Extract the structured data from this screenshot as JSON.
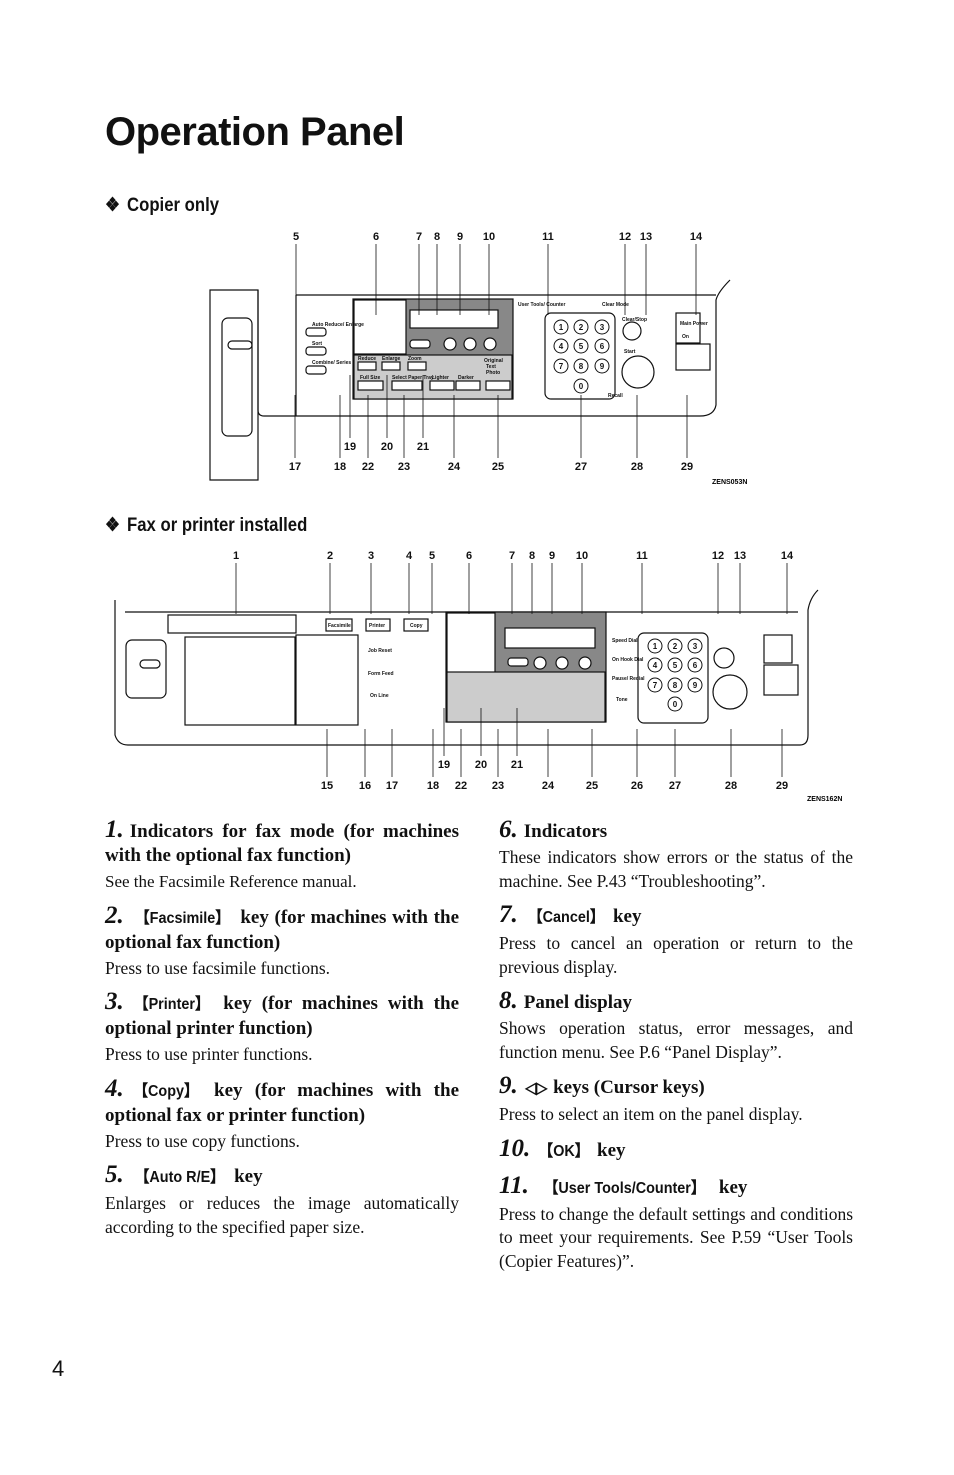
{
  "title": "Operation Panel",
  "sections": [
    {
      "heading": "Copier only",
      "figure_code": "ZENS053N",
      "callouts": [
        "5",
        "6",
        "7",
        "8",
        "9",
        "10",
        "11",
        "12",
        "13",
        "14",
        "17",
        "18",
        "22",
        "23",
        "24",
        "25",
        "27",
        "28",
        "29",
        "19",
        "20",
        "21"
      ],
      "panel_labels": {
        "user_tools": "User Tools/ Counter",
        "clear_mode": "Clear Mode",
        "clear_stop": "Clear/Stop",
        "start": "Start",
        "recall": "Recall",
        "reduce": "Reduce",
        "enlarge": "Enlarge",
        "zoom": "Zoom",
        "full_size": "Full Size",
        "select_paper": "Select Paper Tray",
        "lighter": "Lighter",
        "darker": "Darker",
        "original": "Original",
        "text": "Text",
        "photo": "Photo",
        "auto": "Auto Reduce/ Enlarge",
        "sort": "Sort",
        "combine": "Combine/ Series",
        "main_power": "Main Power",
        "on": "On"
      }
    },
    {
      "heading": "Fax or printer installed",
      "figure_code": "ZENS162N",
      "callouts": [
        "1",
        "2",
        "3",
        "4",
        "5",
        "6",
        "7",
        "8",
        "9",
        "10",
        "11",
        "12",
        "13",
        "14",
        "15",
        "16",
        "17",
        "18",
        "22",
        "23",
        "24",
        "25",
        "26",
        "27",
        "28",
        "29",
        "19",
        "20",
        "21"
      ],
      "panel_labels": {
        "facsimile": "Facsimile",
        "printer": "Printer",
        "copy": "Copy",
        "job_reset": "Job Reset",
        "form_feed": "Form Feed",
        "on_line": "On Line",
        "speed_dial": "Speed Dial",
        "on_hook": "On Hook Dial",
        "pause": "Pause/ Redial",
        "tone": "Tone"
      }
    }
  ],
  "keypad": [
    "1",
    "2",
    "3",
    "4",
    "5",
    "6",
    "7",
    "8",
    "9",
    "0"
  ],
  "items": [
    {
      "num": "1.",
      "title": "Indicators for fax mode (for machines with the optional fax function)",
      "text": "See the Facsimile Reference manual."
    },
    {
      "num": "2.",
      "key": "【Facsimile】",
      "title": "key (for machines with the optional fax function)",
      "text": "Press to use facsimile functions."
    },
    {
      "num": "3.",
      "key": "【Printer】",
      "title": "key (for machines with the optional printer function)",
      "text": "Press to use printer functions."
    },
    {
      "num": "4.",
      "key": "【Copy】",
      "title": "key (for machines with the optional fax or printer function)",
      "text": "Press to use copy functions."
    },
    {
      "num": "5.",
      "key": "【Auto R/E】",
      "title": "key",
      "text": "Enlarges or reduces the image automatically according to the specified paper size."
    },
    {
      "num": "6.",
      "title": "Indicators",
      "text": "These indicators show errors or the status of the machine. See P.43 “Troubleshooting”."
    },
    {
      "num": "7.",
      "key": "【Cancel】",
      "title": "key",
      "text": "Press to cancel an operation or return to the previous display."
    },
    {
      "num": "8.",
      "title": "Panel display",
      "text": "Shows operation status, error messages, and function menu. See P.6 “Panel Display”."
    },
    {
      "num": "9.",
      "key": "◁▷",
      "title": "keys (Cursor keys)",
      "text": "Press to select an item on the panel display."
    },
    {
      "num": "10.",
      "key": "【OK】",
      "title": "key",
      "text": ""
    },
    {
      "num": "11.",
      "key": "【User Tools/Counter】",
      "title": "key",
      "text": "Press to change the default settings and conditions to meet your requirements. See P.59 “User Tools (Copier Features)”."
    }
  ],
  "page_number": "4"
}
